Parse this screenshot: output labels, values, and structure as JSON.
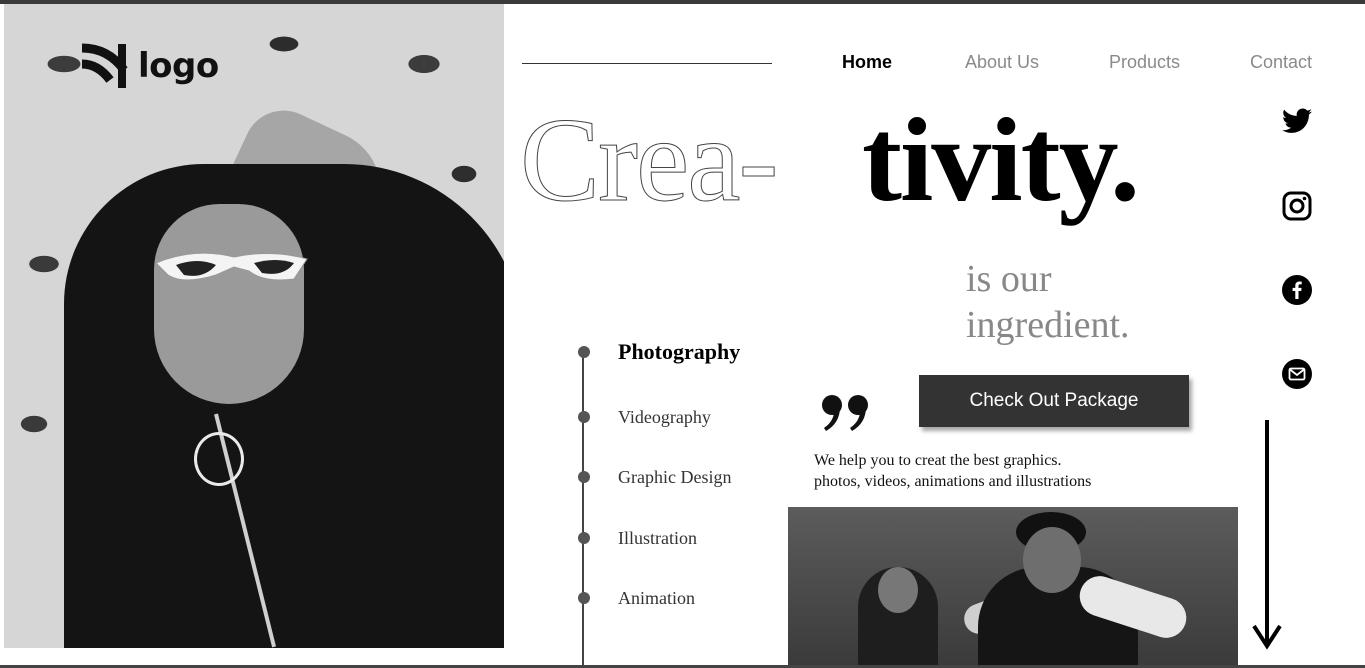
{
  "brand": {
    "logo_text": "logo",
    "logo_icon": "rss-feed-mark"
  },
  "nav": {
    "items": [
      {
        "label": "Home",
        "active": true
      },
      {
        "label": "About Us",
        "active": false
      },
      {
        "label": "Products",
        "active": false
      },
      {
        "label": "Contact",
        "active": false
      }
    ]
  },
  "hero": {
    "headline_outline": "Crea-",
    "headline_solid": "tivity.",
    "tagline_line1": "is our",
    "tagline_line2": "ingredient."
  },
  "social": [
    {
      "name": "twitter",
      "icon": "twitter-icon"
    },
    {
      "name": "instagram",
      "icon": "instagram-icon"
    },
    {
      "name": "facebook",
      "icon": "facebook-icon"
    },
    {
      "name": "email",
      "icon": "mail-icon"
    }
  ],
  "services": {
    "items": [
      {
        "label": "Photography",
        "active": true
      },
      {
        "label": "Videography",
        "active": false
      },
      {
        "label": "Graphic Design",
        "active": false
      },
      {
        "label": "Illustration",
        "active": false
      },
      {
        "label": "Animation",
        "active": false
      }
    ]
  },
  "cta": {
    "label": "Check Out Package"
  },
  "description": {
    "line1": "We help you to creat the best graphics.",
    "line2": "photos, videos, animations and illustrations"
  },
  "colors": {
    "accent_dark": "#333333",
    "muted_text": "#888888",
    "background": "#ffffff"
  }
}
